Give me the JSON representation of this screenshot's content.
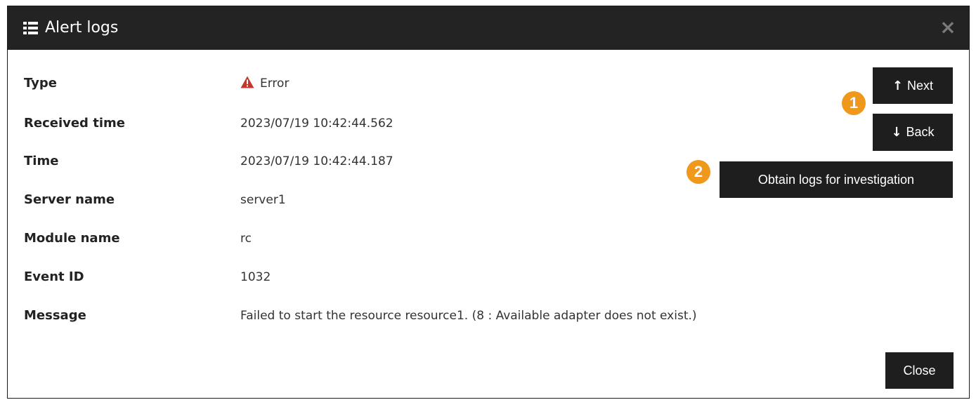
{
  "dialog": {
    "title": "Alert logs",
    "title_icon": "list-icon",
    "close_icon": "close-icon",
    "close_glyph": "×"
  },
  "fields": [
    {
      "label": "Type",
      "value": "Error",
      "icon": "warning-icon"
    },
    {
      "label": "Received time",
      "value": "2023/07/19 10:42:44.562"
    },
    {
      "label": "Time",
      "value": "2023/07/19 10:42:44.187"
    },
    {
      "label": "Server name",
      "value": "server1"
    },
    {
      "label": "Module name",
      "value": "rc"
    },
    {
      "label": "Event ID",
      "value": "1032"
    },
    {
      "label": "Message",
      "value": "Failed to start the resource resource1. (8 : Available adapter does not exist.)"
    }
  ],
  "buttons": {
    "next_label": "Next",
    "next_arrow": "↑",
    "back_label": "Back",
    "back_arrow": "↓",
    "obtain_label": "Obtain logs for investigation",
    "close_label": "Close"
  },
  "callouts": {
    "first": "1",
    "second": "2"
  },
  "colors": {
    "titlebar": "#232323",
    "button": "#1e1e1e",
    "callout": "#f0981c",
    "error_icon": "#c0392b"
  }
}
